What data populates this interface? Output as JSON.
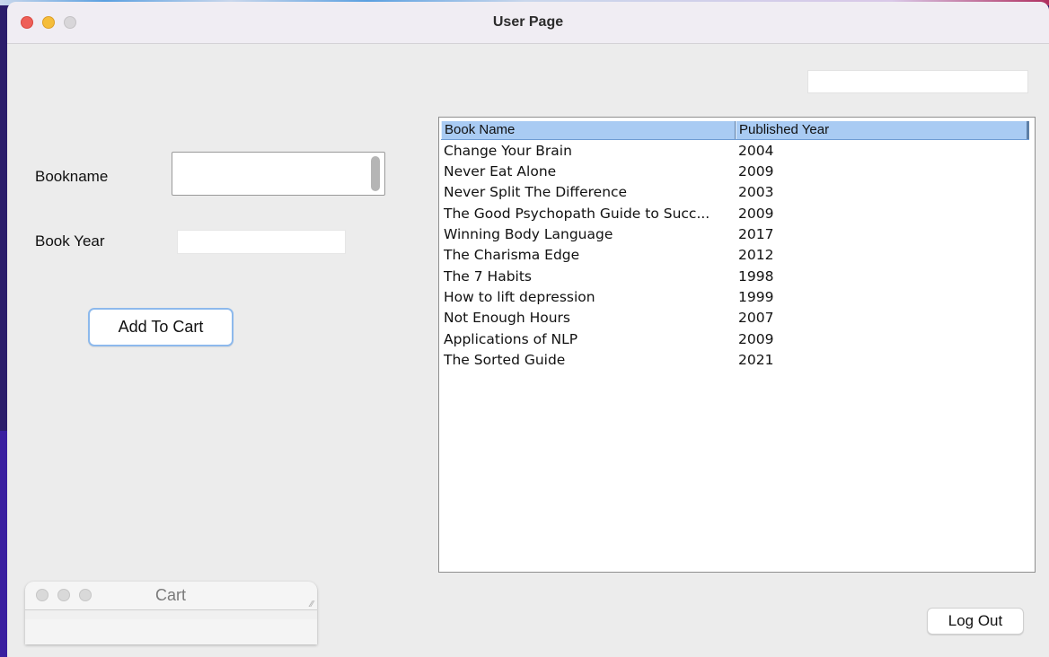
{
  "window": {
    "title": "User Page"
  },
  "form": {
    "bookname_label": "Bookname",
    "bookname_value": "",
    "bookyear_label": "Book Year",
    "bookyear_value": "",
    "add_to_cart_label": "Add To Cart"
  },
  "search": {
    "value": ""
  },
  "table": {
    "columns": [
      "Book Name",
      "Published Year"
    ],
    "rows": [
      {
        "name": "Change Your Brain",
        "year": "2004"
      },
      {
        "name": "Never Eat Alone",
        "year": "2009"
      },
      {
        "name": "Never Split The Difference",
        "year": "2003"
      },
      {
        "name": "The Good Psychopath Guide to Succ...",
        "year": "2009"
      },
      {
        "name": "Winning Body Language",
        "year": "2017"
      },
      {
        "name": "The Charisma Edge",
        "year": "2012"
      },
      {
        "name": "The 7 Habits",
        "year": "1998"
      },
      {
        "name": "How to lift depression",
        "year": "1999"
      },
      {
        "name": "Not Enough Hours",
        "year": "2007"
      },
      {
        "name": "Applications of NLP",
        "year": "2009"
      },
      {
        "name": "The Sorted Guide",
        "year": "2021"
      }
    ]
  },
  "cart_window": {
    "title": "Cart"
  },
  "actions": {
    "logout_label": "Log Out"
  },
  "colors": {
    "traffic_close": "#ee5f58",
    "traffic_minimize": "#f5bd3a",
    "traffic_zoom": "#d8d6d9",
    "table_header": "#a9cbf3",
    "button_focus_border": "#8db9ec"
  }
}
